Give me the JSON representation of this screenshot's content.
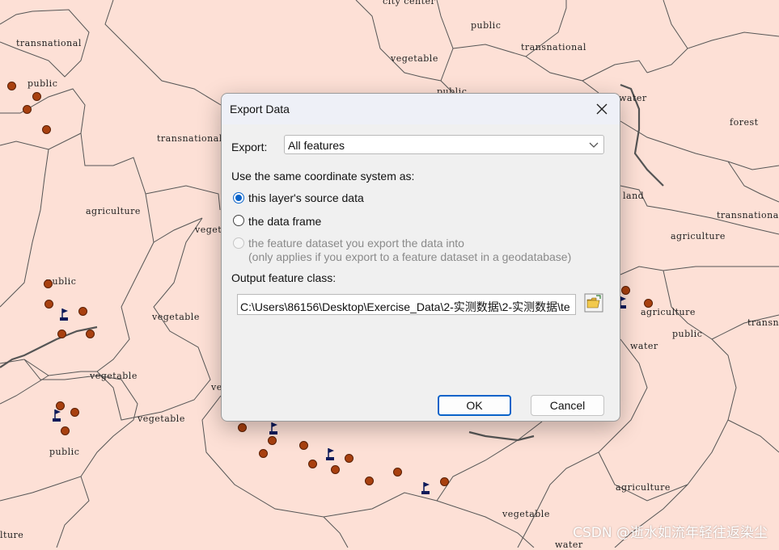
{
  "map": {
    "labels": [
      {
        "text": "city center",
        "cls": "l0"
      },
      {
        "text": "public",
        "cls": "l1"
      },
      {
        "text": "transnational",
        "cls": "l2"
      },
      {
        "text": "transnational",
        "cls": "l3"
      },
      {
        "text": "vegetable",
        "cls": "l4"
      },
      {
        "text": "public",
        "cls": "l5"
      },
      {
        "text": "public",
        "cls": "l6"
      },
      {
        "text": "water",
        "cls": "l7"
      },
      {
        "text": "forest",
        "cls": "l8"
      },
      {
        "text": "transnational",
        "cls": "l9"
      },
      {
        "text": "agriculture",
        "cls": "l10"
      },
      {
        "text": "vegeta",
        "cls": "l11"
      },
      {
        "text": "land",
        "cls": "l12"
      },
      {
        "text": "transnational",
        "cls": "l13"
      },
      {
        "text": "agriculture",
        "cls": "l14"
      },
      {
        "text": "public",
        "cls": "l15"
      },
      {
        "text": "vegetable",
        "cls": "l16"
      },
      {
        "text": "agriculture",
        "cls": "l17"
      },
      {
        "text": "public",
        "cls": "l18"
      },
      {
        "text": "transn",
        "cls": "l19"
      },
      {
        "text": "water",
        "cls": "l20"
      },
      {
        "text": "vegetable",
        "cls": "l21"
      },
      {
        "text": "ve",
        "cls": "l22"
      },
      {
        "text": "vegetable",
        "cls": "l23"
      },
      {
        "text": "public",
        "cls": "l24"
      },
      {
        "text": "agriculture",
        "cls": "l25"
      },
      {
        "text": "vegetable",
        "cls": "l26"
      },
      {
        "text": "lture",
        "cls": "l27"
      },
      {
        "text": "water",
        "cls": "l28"
      }
    ],
    "colors": {
      "background": "#fde0d6",
      "point": "#a8400f",
      "flag": "#0d1a5a",
      "boundary": "#555555"
    }
  },
  "dialog": {
    "title": "Export Data",
    "export_label": "Export:",
    "export_value": "All features",
    "coord_label": "Use the same coordinate system as:",
    "option1": "this layer's source data",
    "option2": "the data frame",
    "option3_line1": "the feature dataset you export the data into",
    "option3_line2": "(only applies if you export to a feature dataset in a geodatabase)",
    "output_label": "Output feature class:",
    "output_value": "C:\\Users\\86156\\Desktop\\Exercise_Data\\2-实测数据\\2-实测数据\\te",
    "ok_label": "OK",
    "cancel_label": "Cancel",
    "selected_option": 1
  },
  "watermark": "CSDN @逝水如流年轻往返染尘"
}
